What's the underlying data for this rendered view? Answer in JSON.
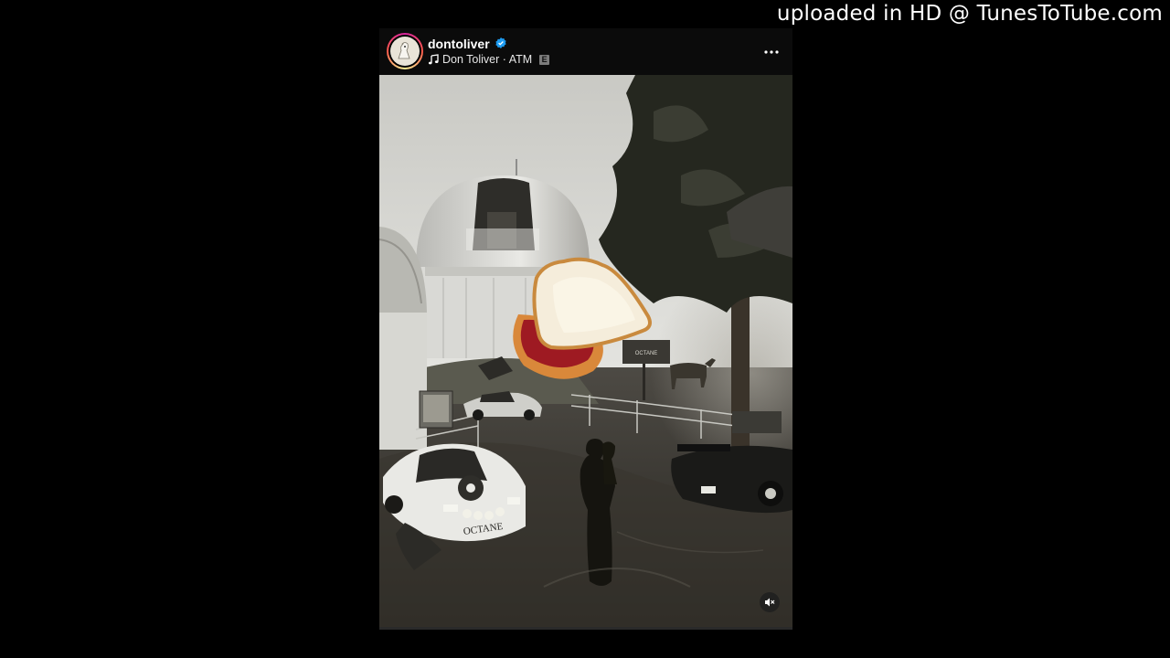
{
  "watermark": "uploaded in HD @ TunesToTube.com",
  "post": {
    "username": "dontoliver",
    "song": "Don Toliver · ATM",
    "explicit_badge": "E",
    "sign_text": "OCTANE",
    "car_text": "OCTANE"
  },
  "icons": {
    "verified": "verified-badge-icon",
    "music": "music-note-icon",
    "more": "more-options-icon",
    "mute": "muted-speaker-icon"
  },
  "colors": {
    "verified": "#1d9bf0",
    "header_bg": "#0b0b0b"
  }
}
